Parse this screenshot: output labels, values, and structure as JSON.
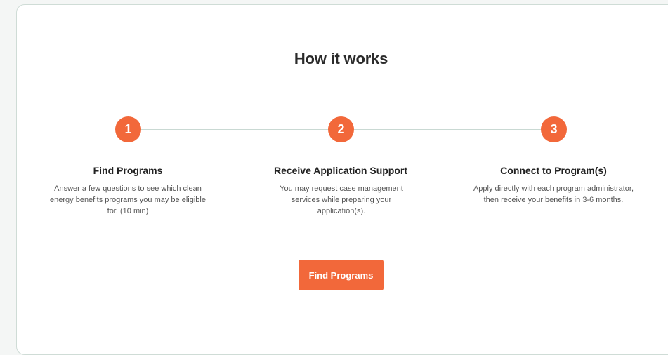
{
  "section": {
    "title": "How it works"
  },
  "steps": [
    {
      "number": "1",
      "title": "Find Programs",
      "description": "Answer a few questions to see which clean energy benefits programs you may be eligible for. (10 min)"
    },
    {
      "number": "2",
      "title": "Receive Application Support",
      "description": "You may request case management services while preparing your application(s)."
    },
    {
      "number": "3",
      "title": "Connect to Program(s)",
      "description": "Apply directly with each program administrator, then receive your benefits in 3-6 months."
    }
  ],
  "cta": {
    "label": "Find Programs"
  },
  "colors": {
    "accent": "#f2683a",
    "connector": "#c9d9d3",
    "background": "#f4f6f5"
  }
}
